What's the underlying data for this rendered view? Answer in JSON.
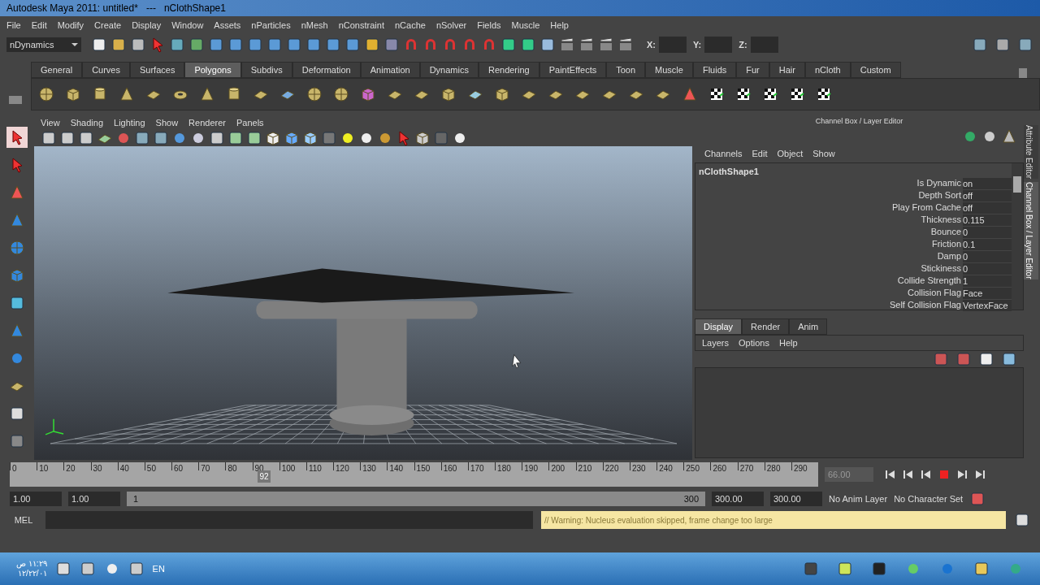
{
  "window": {
    "title": "Autodesk Maya 2011: untitled*   ---   nClothShape1"
  },
  "menu": [
    "File",
    "Edit",
    "Modify",
    "Create",
    "Display",
    "Window",
    "Assets",
    "nParticles",
    "nMesh",
    "nConstraint",
    "nCache",
    "nSolver",
    "Fields",
    "Muscle",
    "Help"
  ],
  "status_line": {
    "menu_set": "nDynamics",
    "coord_labels": [
      "X:",
      "Y:",
      "Z:"
    ]
  },
  "shelf_tabs": [
    {
      "label": "General",
      "selected": false
    },
    {
      "label": "Curves",
      "selected": false
    },
    {
      "label": "Surfaces",
      "selected": false
    },
    {
      "label": "Polygons",
      "selected": true
    },
    {
      "label": "Subdivs",
      "selected": false
    },
    {
      "label": "Deformation",
      "selected": false
    },
    {
      "label": "Animation",
      "selected": false
    },
    {
      "label": "Dynamics",
      "selected": false
    },
    {
      "label": "Rendering",
      "selected": false
    },
    {
      "label": "PaintEffects",
      "selected": false
    },
    {
      "label": "Toon",
      "selected": false
    },
    {
      "label": "Muscle",
      "selected": false
    },
    {
      "label": "Fluids",
      "selected": false
    },
    {
      "label": "Fur",
      "selected": false
    },
    {
      "label": "Hair",
      "selected": false
    },
    {
      "label": "nCloth",
      "selected": false
    },
    {
      "label": "Custom",
      "selected": false
    }
  ],
  "viewport": {
    "menus": [
      "View",
      "Shading",
      "Lighting",
      "Show",
      "Renderer",
      "Panels"
    ]
  },
  "channel_box": {
    "title": "Channel Box / Layer Editor",
    "menus": [
      "Channels",
      "Edit",
      "Object",
      "Show"
    ],
    "node": "nClothShape1",
    "attributes": [
      {
        "name": "Is Dynamic",
        "value": "on"
      },
      {
        "name": "Depth Sort",
        "value": "off"
      },
      {
        "name": "Play From Cache",
        "value": "off"
      },
      {
        "name": "Thickness",
        "value": "0.115"
      },
      {
        "name": "Bounce",
        "value": "0"
      },
      {
        "name": "Friction",
        "value": "0.1"
      },
      {
        "name": "Damp",
        "value": "0"
      },
      {
        "name": "Stickiness",
        "value": "0"
      },
      {
        "name": "Collide Strength",
        "value": "1"
      },
      {
        "name": "Collision Flag",
        "value": "Face"
      },
      {
        "name": "Self Collision Flag",
        "value": "VertexFace"
      }
    ],
    "tabs": [
      {
        "label": "Display",
        "selected": true
      },
      {
        "label": "Render",
        "selected": false
      },
      {
        "label": "Anim",
        "selected": false
      }
    ],
    "layer_menus": [
      "Layers",
      "Options",
      "Help"
    ]
  },
  "side_tabs": [
    {
      "label": "Attribute Editor",
      "selected": false
    },
    {
      "label": "Channel Box / Layer Editor",
      "selected": true
    }
  ],
  "timeline": {
    "ticks": [
      "0",
      "10",
      "20",
      "30",
      "40",
      "50",
      "60",
      "70",
      "80",
      "90",
      "100",
      "110",
      "120",
      "130",
      "140",
      "150",
      "160",
      "170",
      "180",
      "190",
      "200",
      "210",
      "220",
      "230",
      "240",
      "250",
      "260",
      "270",
      "280",
      "290"
    ],
    "current_frame": "92",
    "level": 0.307,
    "current_field": "66.00"
  },
  "range": {
    "start": "1.00",
    "playback_start": "1.00",
    "level": 1,
    "slider_start": "1",
    "slider_end": "300",
    "playback_end": "300.00",
    "end": "300.00",
    "anim_layer": "No Anim Layer",
    "character_set": "No Character Set"
  },
  "command_line": {
    "label": "MEL",
    "message": "// Warning: Nucleus evaluation skipped, frame change too large"
  },
  "taskbar": {
    "time": "١١:٢٩ ص",
    "date": "١٢/٢٢/٠١",
    "language": "EN"
  }
}
